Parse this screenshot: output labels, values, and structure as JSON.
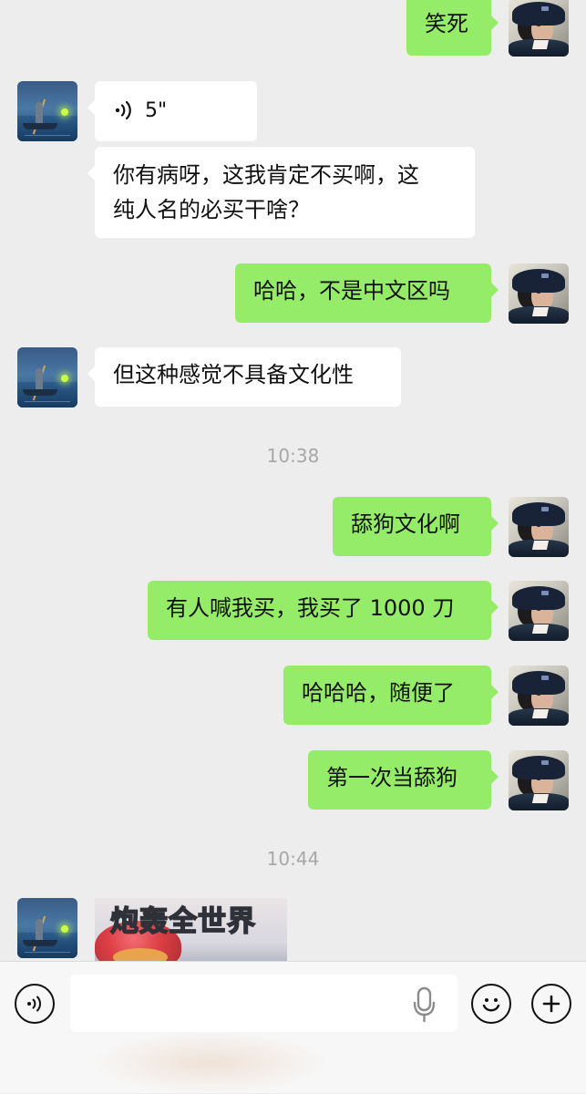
{
  "chat": {
    "messages": [
      {
        "text": "笑死"
      },
      {
        "voice_duration": "5\""
      },
      {
        "text": "你有病呀，这我肯定不买啊，这\n纯人名的必买干啥？"
      },
      {
        "text": "哈哈，不是中文区吗"
      },
      {
        "text": "但这种感觉不具备文化性"
      },
      {
        "text": "舔狗文化啊"
      },
      {
        "text": "有人喊我买，我买了 1000 刀"
      },
      {
        "text": "哈哈哈，随便了"
      },
      {
        "text": "第一次当舔狗"
      },
      {
        "sticker_text": "炮轰全世界"
      }
    ],
    "timestamps": [
      "10:38",
      "10:44"
    ]
  },
  "icons": {
    "voice_message": "voice-wave-icon",
    "voice_toggle": "voice-input-icon",
    "mic": "microphone-icon",
    "emoji": "emoji-icon",
    "add": "add-icon"
  },
  "colors": {
    "chat_background": "#ededed",
    "outgoing_bubble": "#95ec69",
    "incoming_bubble": "#ffffff",
    "timestamp_text": "#a7a7a7",
    "input_bar": "#f7f7f7"
  }
}
